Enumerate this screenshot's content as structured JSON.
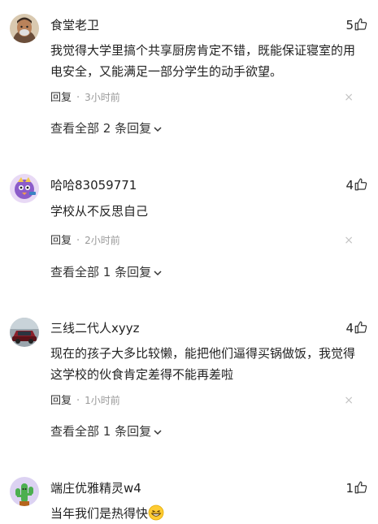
{
  "comments": [
    {
      "username": "食堂老卫",
      "likes": "5",
      "text": "我觉得大学里搞个共享厨房肯定不错，既能保证寝室的用电安全，又能满足一部分学生的动手欲望。",
      "reply_label": "回复",
      "separator": "·",
      "time": "3小时前",
      "close": "×",
      "view_replies": "查看全部 2 条回复",
      "avatar_icon": "man-portrait-avatar"
    },
    {
      "username": "哈哈83059771",
      "likes": "4",
      "text": "学校从不反思自己",
      "reply_label": "回复",
      "separator": "·",
      "time": "2小时前",
      "close": "×",
      "view_replies": "查看全部 1 条回复",
      "avatar_icon": "purple-bird-avatar"
    },
    {
      "username": "三线二代人xyyz",
      "likes": "4",
      "text": "现在的孩子大多比较懒，能把他们逼得买锅做饭，我觉得这学校的伙食肯定差得不能再差啦",
      "reply_label": "回复",
      "separator": "·",
      "time": "1小时前",
      "close": "×",
      "view_replies": "查看全部 1 条回复",
      "avatar_icon": "car-photo-avatar"
    },
    {
      "username": "端庄优雅精灵w4",
      "likes": "1",
      "text": "当年我们是热得快",
      "emoji": "grinning-emoji",
      "avatar_icon": "cactus-avatar"
    }
  ],
  "colors": {
    "text": "#222222",
    "muted": "#999999",
    "close": "#c4c4c4"
  }
}
